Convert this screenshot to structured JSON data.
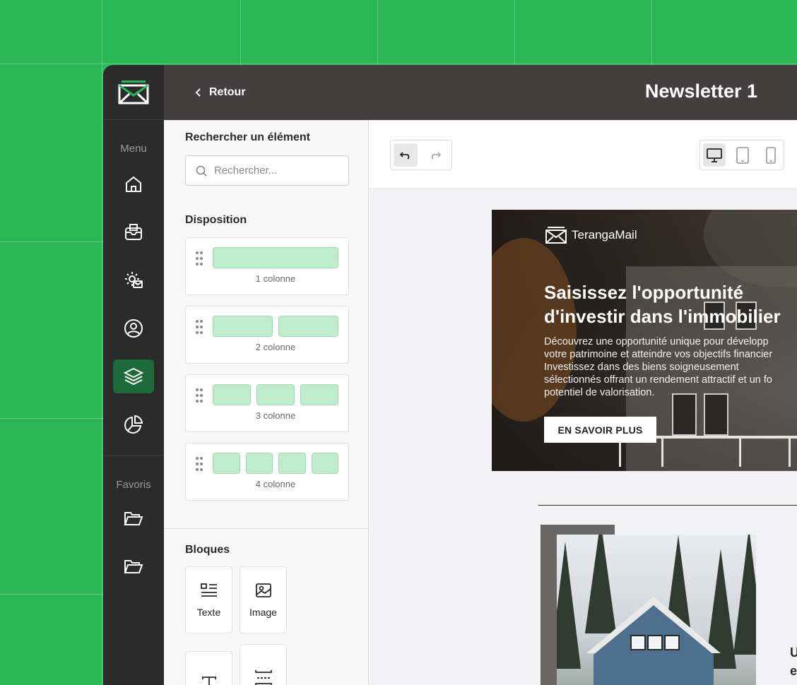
{
  "colors": {
    "brand_green": "#2bb755",
    "sidebar_bg": "#2b2b2b",
    "header_bg": "#433f3e",
    "active_nav": "#1e6b3a",
    "layout_fill": "#bfeccd"
  },
  "sidebar": {
    "menu_label": "Menu",
    "items": [
      {
        "icon": "home-icon"
      },
      {
        "icon": "mail-inbox-icon"
      },
      {
        "icon": "settings-mail-icon"
      },
      {
        "icon": "user-icon"
      },
      {
        "icon": "layers-icon",
        "active": true
      },
      {
        "icon": "pie-chart-icon"
      }
    ],
    "favorites_label": "Favoris",
    "favorites": [
      {
        "icon": "folder-open-icon"
      },
      {
        "icon": "folder-open-icon"
      }
    ]
  },
  "header": {
    "back_label": "Retour",
    "title": "Newsletter 1"
  },
  "panel": {
    "search_title": "Rechercher un élément",
    "search_placeholder": "Rechercher...",
    "layout_title": "Disposition",
    "layouts": [
      {
        "label": "1 colonne",
        "cols": 1
      },
      {
        "label": "2 colonne",
        "cols": 2
      },
      {
        "label": "3 colonne",
        "cols": 3
      },
      {
        "label": "4 colonne",
        "cols": 4
      }
    ],
    "blocks_title": "Bloques",
    "blocks": [
      {
        "label": "Texte",
        "icon": "text-list-icon"
      },
      {
        "label": "Image",
        "icon": "image-icon"
      },
      {
        "label": "",
        "icon": "typography-icon"
      },
      {
        "label": "",
        "icon": "spacer-icon"
      }
    ]
  },
  "toolbar": {
    "undo": "undo-icon",
    "redo": "redo-icon",
    "devices": [
      "desktop-icon",
      "tablet-icon",
      "mobile-icon"
    ]
  },
  "email": {
    "brand": "TerangaMail",
    "hero_title": "Saisissez l'opportunité d'investir dans l'immobilier",
    "hero_text": "Découvrez une opportunité unique pour développ\nvotre patrimoine et atteindre vos objectifs financier\nInvestissez dans des biens soigneusement\nsélectionnés offrant un rendement attractif et un fo\npotentiel de valorisation.",
    "cta_label": "EN SAVOIR PLUS",
    "side_text_1": "U",
    "side_text_2": "e"
  }
}
